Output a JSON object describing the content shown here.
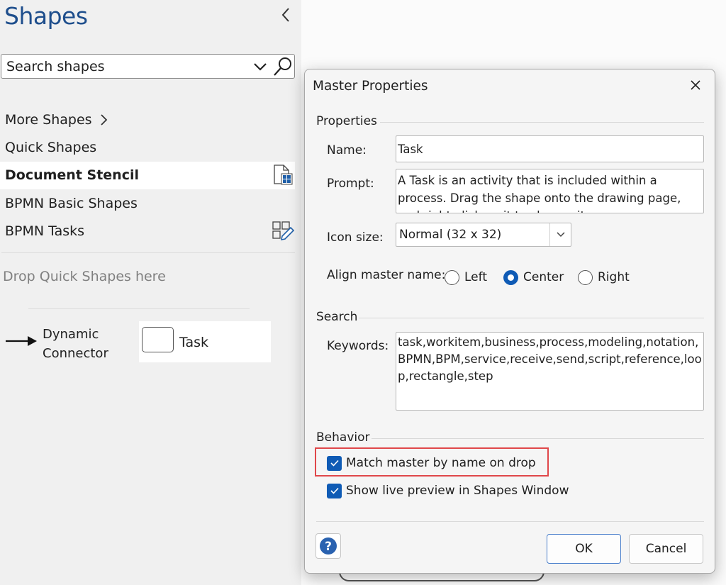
{
  "shapes_pane": {
    "title": "Shapes",
    "search": {
      "placeholder": "Search shapes"
    },
    "stencils": [
      {
        "label": "More Shapes"
      },
      {
        "label": "Quick Shapes"
      },
      {
        "label": "Document Stencil"
      },
      {
        "label": "BPMN Basic Shapes"
      },
      {
        "label": "BPMN Tasks"
      }
    ],
    "drop_hint": "Drop Quick Shapes here",
    "masters": [
      {
        "label_line1": "Dynamic",
        "label_line2": "Connector"
      },
      {
        "label": "Task"
      }
    ]
  },
  "dialog": {
    "title": "Master Properties",
    "properties_header": "Properties",
    "name_label": "Name:",
    "name_value": "Task",
    "prompt_label": "Prompt:",
    "prompt_value": "A Task is an activity that is included within a process. Drag the shape onto the drawing page, and right-click on it to change its",
    "icon_size_label": "Icon size:",
    "icon_size_value": "Normal (32 x 32)",
    "align_label": "Align master name:",
    "align_options": [
      {
        "label": "Left",
        "checked": false
      },
      {
        "label": "Center",
        "checked": true
      },
      {
        "label": "Right",
        "checked": false
      }
    ],
    "search_header": "Search",
    "keywords_label": "Keywords:",
    "keywords_value": "task,workitem,business,process,modeling,notation,BPMN,BPM,service,receive,send,script,reference,loop,rectangle,step",
    "behavior_header": "Behavior",
    "checkboxes": [
      {
        "label": "Match master by name on drop",
        "checked": true
      },
      {
        "label": "Show live preview in Shapes Window",
        "checked": true
      }
    ],
    "help_label": "?",
    "ok_label": "OK",
    "cancel_label": "Cancel"
  },
  "colors": {
    "accent": "#0f5bb5",
    "title_blue": "#1e4e8c",
    "highlight": "#e0474a"
  }
}
